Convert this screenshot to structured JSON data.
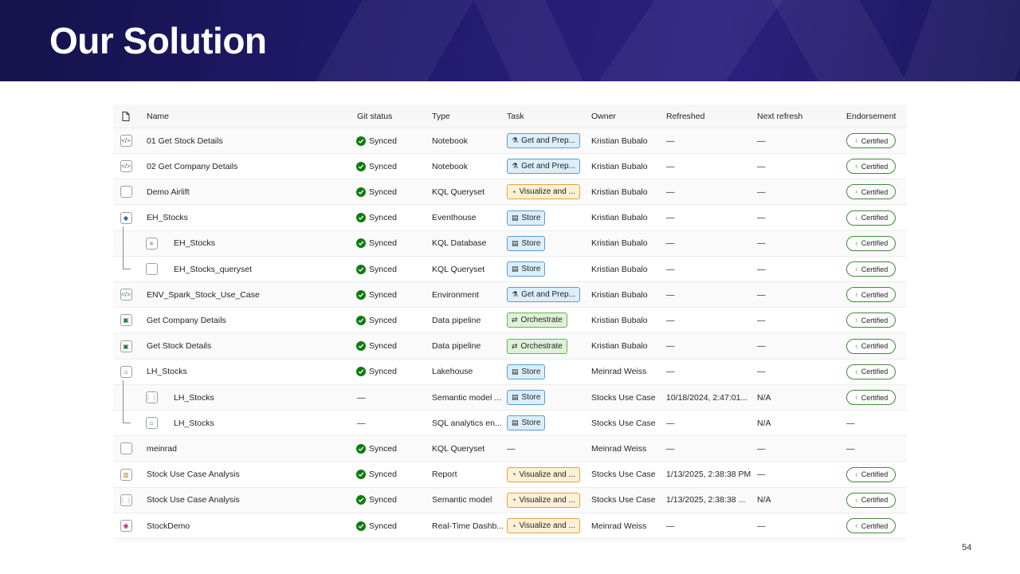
{
  "slide": {
    "title": "Our Solution",
    "page_number": "54"
  },
  "table": {
    "columns": {
      "name": "Name",
      "git_status": "Git status",
      "type": "Type",
      "task": "Task",
      "owner": "Owner",
      "refreshed": "Refreshed",
      "next_refresh": "Next refresh",
      "endorsement": "Endorsement"
    },
    "rows": [
      {
        "name": "01 Get Stock Details",
        "icon": "notebook-icon",
        "git": "Synced",
        "type": "Notebook",
        "task": "Get and Prep...",
        "task_kind": "blue",
        "owner": "Kristian Bubalo",
        "refreshed": "—",
        "next": "—",
        "endorsement": "Certified"
      },
      {
        "name": "02 Get Company Details",
        "icon": "notebook-icon",
        "git": "Synced",
        "type": "Notebook",
        "task": "Get and Prep...",
        "task_kind": "blue",
        "owner": "Kristian Bubalo",
        "refreshed": "—",
        "next": "—",
        "endorsement": "Certified"
      },
      {
        "name": "Demo Airlift",
        "icon": "queryset-icon",
        "git": "Synced",
        "type": "KQL Queryset",
        "task": "Visualize and ...",
        "task_kind": "orange",
        "owner": "Kristian Bubalo",
        "refreshed": "—",
        "next": "—",
        "endorsement": "Certified"
      },
      {
        "name": "EH_Stocks",
        "icon": "eventhouse-icon",
        "git": "Synced",
        "type": "Eventhouse",
        "task": "Store",
        "task_kind": "store",
        "owner": "Kristian Bubalo",
        "refreshed": "—",
        "next": "—",
        "endorsement": "Certified"
      },
      {
        "name": "EH_Stocks",
        "icon": "kql-database-icon",
        "git": "Synced",
        "type": "KQL Database",
        "task": "Store",
        "task_kind": "store",
        "owner": "Kristian Bubalo",
        "refreshed": "—",
        "next": "—",
        "endorsement": "Certified"
      },
      {
        "name": "EH_Stocks_queryset",
        "icon": "queryset-icon",
        "git": "Synced",
        "type": "KQL Queryset",
        "task": "Store",
        "task_kind": "store",
        "owner": "Kristian Bubalo",
        "refreshed": "—",
        "next": "—",
        "endorsement": "Certified"
      },
      {
        "name": "ENV_Spark_Stock_Use_Case",
        "icon": "environment-icon",
        "git": "Synced",
        "type": "Environment",
        "task": "Get and Prep...",
        "task_kind": "blue",
        "owner": "Kristian Bubalo",
        "refreshed": "—",
        "next": "—",
        "endorsement": "Certified"
      },
      {
        "name": "Get Company Details",
        "icon": "pipeline-icon",
        "git": "Synced",
        "type": "Data pipeline",
        "task": "Orchestrate",
        "task_kind": "green",
        "owner": "Kristian Bubalo",
        "refreshed": "—",
        "next": "—",
        "endorsement": "Certified"
      },
      {
        "name": "Get Stock Details",
        "icon": "pipeline-icon",
        "git": "Synced",
        "type": "Data pipeline",
        "task": "Orchestrate",
        "task_kind": "green",
        "owner": "Kristian Bubalo",
        "refreshed": "—",
        "next": "—",
        "endorsement": "Certified"
      },
      {
        "name": "LH_Stocks",
        "icon": "lakehouse-icon",
        "git": "Synced",
        "type": "Lakehouse",
        "task": "Store",
        "task_kind": "store",
        "owner": "Meinrad Weiss",
        "refreshed": "—",
        "next": "—",
        "endorsement": "Certified"
      },
      {
        "name": "LH_Stocks",
        "icon": "semantic-model-icon",
        "git": "—",
        "type": "Semantic model ...",
        "task": "Store",
        "task_kind": "store",
        "owner": "Stocks Use Case",
        "refreshed": "10/18/2024, 2:47:01...",
        "next": "N/A",
        "endorsement": "Certified"
      },
      {
        "name": "LH_Stocks",
        "icon": "sql-endpoint-icon",
        "git": "—",
        "type": "SQL analytics en...",
        "task": "Store",
        "task_kind": "store",
        "owner": "Stocks Use Case",
        "refreshed": "—",
        "next": "N/A",
        "endorsement": "—"
      },
      {
        "name": "meinrad",
        "icon": "queryset-icon",
        "git": "Synced",
        "type": "KQL Queryset",
        "task": "—",
        "task_kind": "none",
        "owner": "Meinrad Weiss",
        "refreshed": "—",
        "next": "—",
        "endorsement": "—"
      },
      {
        "name": "Stock Use Case Analysis",
        "icon": "report-icon",
        "git": "Synced",
        "type": "Report",
        "task": "Visualize and ...",
        "task_kind": "orange",
        "owner": "Stocks Use Case",
        "refreshed": "1/13/2025, 2:38:38 PM",
        "next": "—",
        "endorsement": "Certified"
      },
      {
        "name": "Stock Use Case Analysis",
        "icon": "semantic-model-icon",
        "git": "Synced",
        "type": "Semantic model",
        "task": "Visualize and ...",
        "task_kind": "orange",
        "owner": "Stocks Use Case",
        "refreshed": "1/13/2025, 2:38:38 ...",
        "next": "N/A",
        "endorsement": "Certified"
      },
      {
        "name": "StockDemo",
        "icon": "dashboard-icon",
        "git": "Synced",
        "type": "Real-Time Dashb...",
        "task": "Visualize and ...",
        "task_kind": "orange",
        "owner": "Meinrad Weiss",
        "refreshed": "—",
        "next": "—",
        "endorsement": "Certified"
      }
    ]
  },
  "colors": {
    "synced": "#107c10",
    "certified_border": "#3f8a36",
    "banner": "#221a6e"
  }
}
